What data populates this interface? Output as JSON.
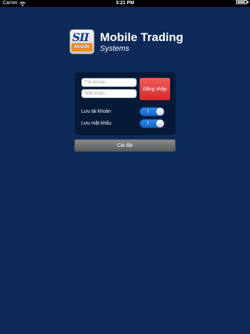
{
  "status_bar": {
    "carrier": "Carrier",
    "time": "3:21 PM",
    "wifi_icon": "wifi-icon",
    "battery_icon": "battery-icon"
  },
  "logo": {
    "badge_top": "SII",
    "badge_bottom": "Mobile",
    "title": "Mobile Trading",
    "subtitle": "Systems"
  },
  "login": {
    "account_placeholder": "Tài khoản",
    "password_placeholder": "Mật khẩu",
    "login_label": "Đăng nhập",
    "remember_account_label": "Lưu tài khoản",
    "remember_password_label": "Lưu mật khẩu",
    "remember_account_on": true,
    "remember_password_on": true,
    "toggle_on_mark": "I"
  },
  "settings": {
    "label": "Cài đặt"
  },
  "colors": {
    "background": "#0d2a58",
    "panel": "#061a38",
    "login_button": "#d42a2a",
    "toggle_on": "#1766c6"
  }
}
